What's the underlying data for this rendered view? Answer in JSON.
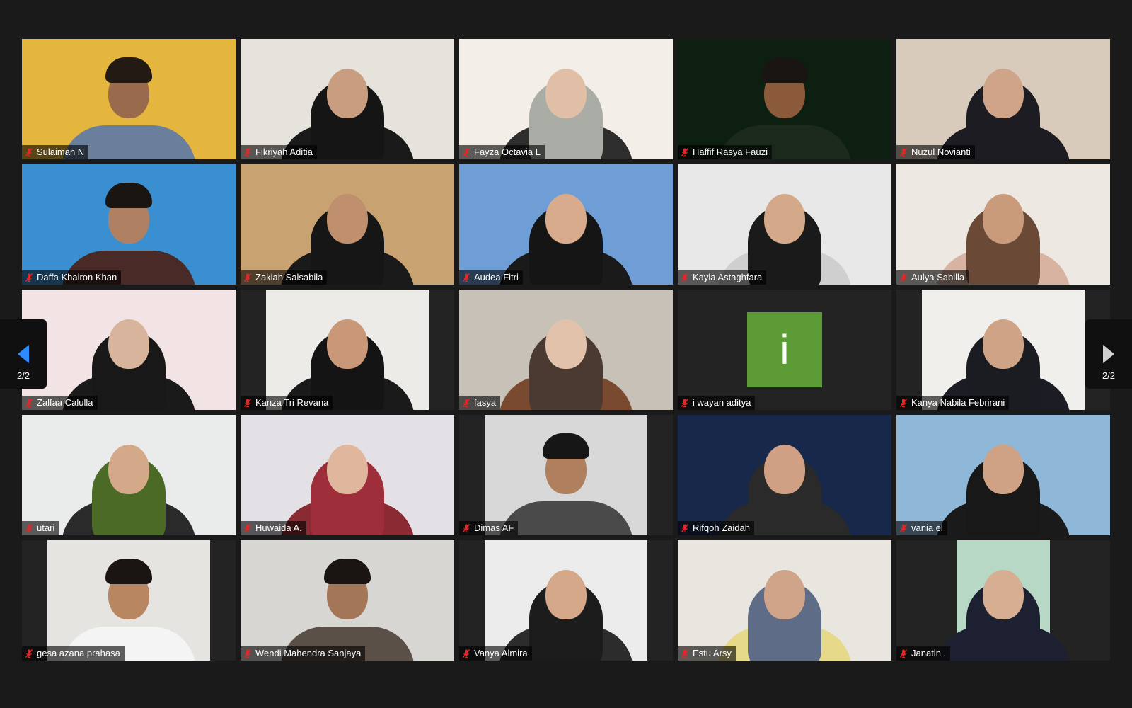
{
  "pagination": {
    "prev_label": "2/2",
    "next_label": "2/2",
    "prev_arrow_color": "#2d8cff",
    "next_arrow_color": "#cfcfcf"
  },
  "participants": [
    {
      "name": "Sulaiman N",
      "muted": true,
      "bg": "#e5b63e",
      "kind": "man",
      "skin": "#9a6a4c",
      "cloth": "#6a7f9c",
      "veil": "#231a14"
    },
    {
      "name": "Fikriyah Aditia",
      "muted": true,
      "bg": "#e6e3dc",
      "kind": "hijab",
      "skin": "#c89d80",
      "cloth": "#1a1a1a",
      "veil": "#151515"
    },
    {
      "name": "Fayza Octavia L",
      "muted": true,
      "bg": "#f4eee8",
      "kind": "hijab",
      "skin": "#e0bfa6",
      "cloth": "#2e2e2e",
      "veil": "#a9ada6"
    },
    {
      "name": "Haffif Rasya Fauzi",
      "muted": true,
      "bg": "#0d1f10",
      "kind": "man",
      "skin": "#8a5a3a",
      "cloth": "#1b2a1c",
      "veil": "#1a1412"
    },
    {
      "name": "Nuzul Novianti",
      "muted": true,
      "bg": "#d9cbbb",
      "kind": "hijab",
      "skin": "#cfa488",
      "cloth": "#1c1c22",
      "veil": "#1c1c22"
    },
    {
      "name": "Daffa Khairon Khan",
      "muted": true,
      "bg": "#3a8fd0",
      "kind": "man",
      "skin": "#b08062",
      "cloth": "#4a2a26",
      "veil": "#1b1512"
    },
    {
      "name": "Zakiah Salsabila",
      "muted": true,
      "bg": "#c9a272",
      "kind": "hijab",
      "skin": "#c0906e",
      "cloth": "#1a1a1a",
      "veil": "#161616"
    },
    {
      "name": "Audea Fitri",
      "muted": true,
      "bg": "#6f9ed6",
      "kind": "hijab",
      "skin": "#d7ab8c",
      "cloth": "#1a1a1a",
      "veil": "#151515"
    },
    {
      "name": "Kayla Astaghfara",
      "muted": true,
      "bg": "#e8e8e8",
      "kind": "hijab",
      "skin": "#d4a98a",
      "cloth": "#cfcfcf",
      "veil": "#1a1a1a"
    },
    {
      "name": "Aulya Sabilla",
      "muted": true,
      "bg": "#ede8e2",
      "kind": "hijab",
      "skin": "#c99b7a",
      "cloth": "#d9b3a2",
      "veil": "#6a4a36"
    },
    {
      "name": "Zalfaa Calulla",
      "muted": true,
      "bg": "#f2e4e4",
      "kind": "hijab",
      "skin": "#d8b49c",
      "cloth": "#1a1a1a",
      "veil": "#181818"
    },
    {
      "name": "Kanza Tri Revana",
      "muted": true,
      "bg": "#ecebe7",
      "kind": "hijab",
      "skin": "#c99878",
      "cloth": "#1a1a1a",
      "veil": "#141414",
      "frame": "narrow"
    },
    {
      "name": "fasya",
      "muted": true,
      "bg": "#c7c1b8",
      "kind": "hijab",
      "skin": "#e2c2aa",
      "cloth": "#7a4a30",
      "veil": "#4a3a32"
    },
    {
      "name": "i wayan aditya",
      "muted": true,
      "bg": "#232323",
      "kind": "avatar",
      "avatar_letter": "i",
      "avatar_color": "#5c9b36"
    },
    {
      "name": "Kanya Nabila Febrirani",
      "muted": true,
      "bg": "#f1efec",
      "kind": "hijab",
      "skin": "#cfa486",
      "cloth": "#1c1c24",
      "veil": "#1b1b22",
      "frame": "narrow"
    },
    {
      "name": "utari",
      "muted": true,
      "bg": "#e9ecea",
      "kind": "hijab",
      "skin": "#d3a98a",
      "cloth": "#2a2a2a",
      "veil": "#4b6a26"
    },
    {
      "name": "Huwaida A.",
      "muted": true,
      "bg": "#e4e1e6",
      "kind": "hijab",
      "skin": "#e0b79c",
      "cloth": "#8a2a32",
      "veil": "#9e2f3a"
    },
    {
      "name": "Dimas AF",
      "muted": true,
      "bg": "#d8d8d8",
      "kind": "man",
      "skin": "#b0805e",
      "cloth": "#4a4a4a",
      "veil": "#161616",
      "frame": "narrow"
    },
    {
      "name": "Rifqoh Zaidah",
      "muted": true,
      "bg": "#18284a",
      "kind": "hijab",
      "skin": "#cfa084",
      "cloth": "#2a2a2a",
      "veil": "#2a2a2a"
    },
    {
      "name": "vania el",
      "muted": true,
      "bg": "#8fb8d8",
      "kind": "hijab",
      "skin": "#cfa286",
      "cloth": "#1a1a1a",
      "veil": "#181818"
    },
    {
      "name": "gesa azana prahasa",
      "muted": true,
      "bg": "#e6e4e0",
      "kind": "man",
      "skin": "#b98662",
      "cloth": "#f4f4f4",
      "veil": "#1a1412",
      "frame": "narrow"
    },
    {
      "name": "Wendi Mahendra Sanjaya",
      "muted": true,
      "bg": "#d8d6d2",
      "kind": "man",
      "skin": "#a37658",
      "cloth": "#5a5048",
      "veil": "#1a1412"
    },
    {
      "name": "Vanya Almira",
      "muted": true,
      "bg": "#ececec",
      "kind": "hijab",
      "skin": "#d4a888",
      "cloth": "#2c2c2c",
      "veil": "#1c1c1c",
      "frame": "narrow"
    },
    {
      "name": "Estu Arsy",
      "muted": true,
      "bg": "#e9e6e0",
      "kind": "hijab",
      "skin": "#cfa488",
      "cloth": "#e6d98a",
      "veil": "#5f6c88"
    },
    {
      "name": "Janatin .",
      "muted": true,
      "bg": "#b8d8c6",
      "kind": "hijab",
      "skin": "#d6ae92",
      "cloth": "#1c2030",
      "veil": "#1c2030",
      "frame": "vnarrow"
    }
  ]
}
